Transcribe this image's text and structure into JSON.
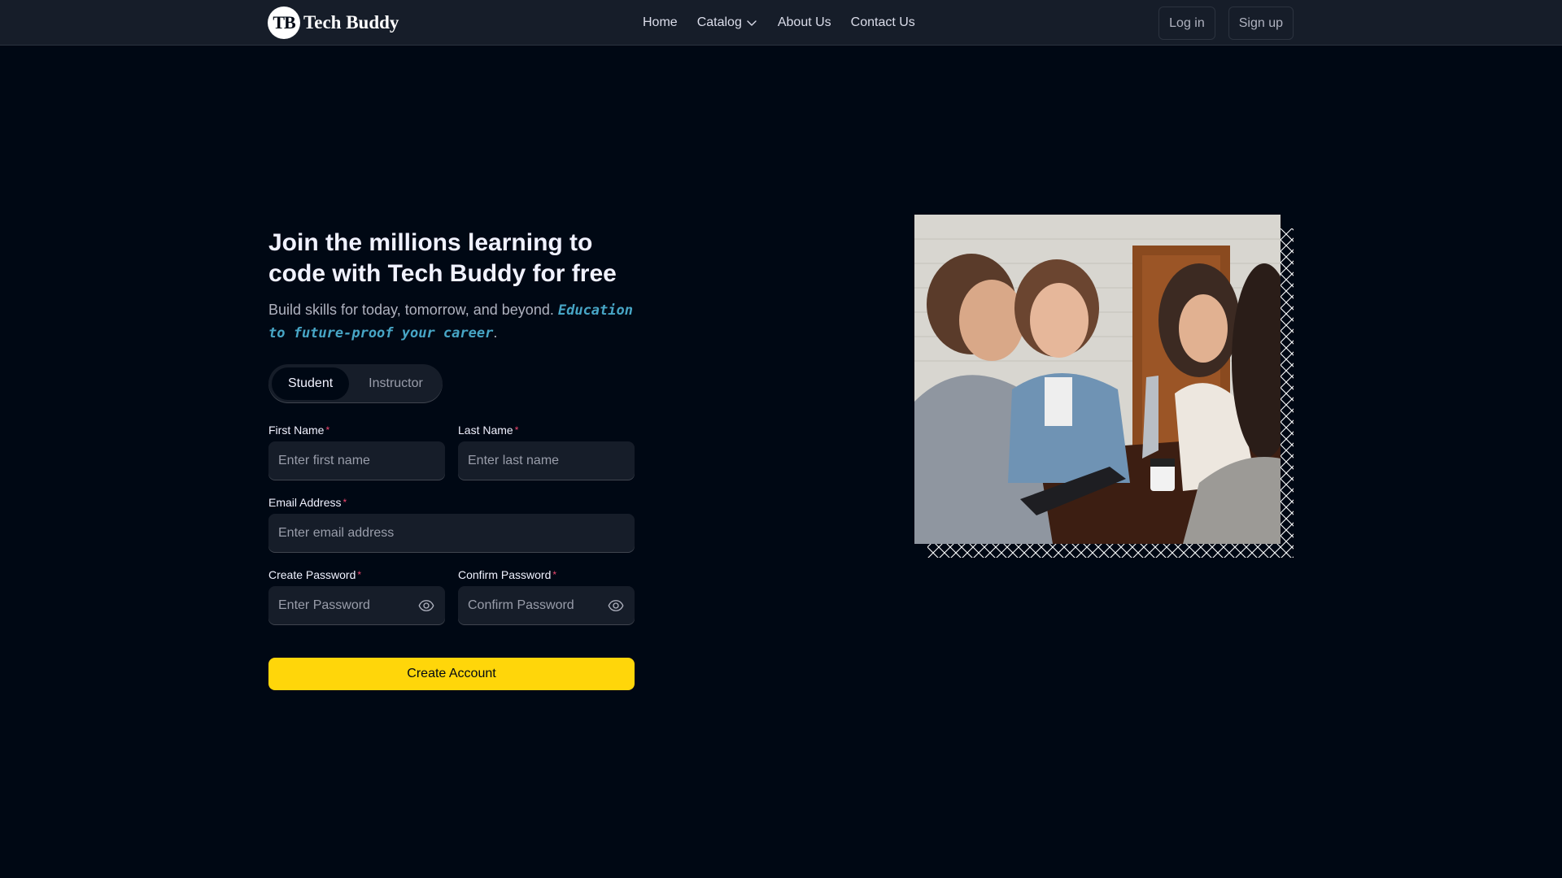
{
  "brand": {
    "logo_text": "TB",
    "name": "Tech Buddy"
  },
  "nav": {
    "links": [
      {
        "label": "Home"
      },
      {
        "label": "Catalog",
        "has_dropdown": true
      },
      {
        "label": "About Us"
      },
      {
        "label": "Contact Us"
      }
    ]
  },
  "auth": {
    "login": "Log in",
    "signup": "Sign up"
  },
  "hero": {
    "heading": "Join the millions learning to code with Tech Buddy for free",
    "subtitle": "Build skills for today, tomorrow, and beyond.",
    "highlight": "Education to future-proof your career",
    "highlight_suffix": "."
  },
  "roles": {
    "student": "Student",
    "instructor": "Instructor",
    "selected": "Student"
  },
  "form": {
    "first_name": {
      "label": "First Name",
      "placeholder": "Enter first name",
      "value": ""
    },
    "last_name": {
      "label": "Last Name",
      "placeholder": "Enter last name",
      "value": ""
    },
    "email": {
      "label": "Email Address",
      "placeholder": "Enter email address",
      "value": ""
    },
    "password": {
      "label": "Create Password",
      "placeholder": "Enter Password",
      "value": ""
    },
    "confirm_password": {
      "label": "Confirm Password",
      "placeholder": "Confirm Password",
      "value": ""
    },
    "required_marker": "*",
    "submit": "Create Account"
  },
  "colors": {
    "background": "#000814",
    "navbar": "#161D29",
    "accent_yellow": "#FFD60A",
    "highlight_blue": "#47A5C5",
    "required_red": "#EF476F"
  },
  "icons": {
    "catalog_dropdown": "chevron-down-icon",
    "password_toggle": "eye-icon"
  }
}
